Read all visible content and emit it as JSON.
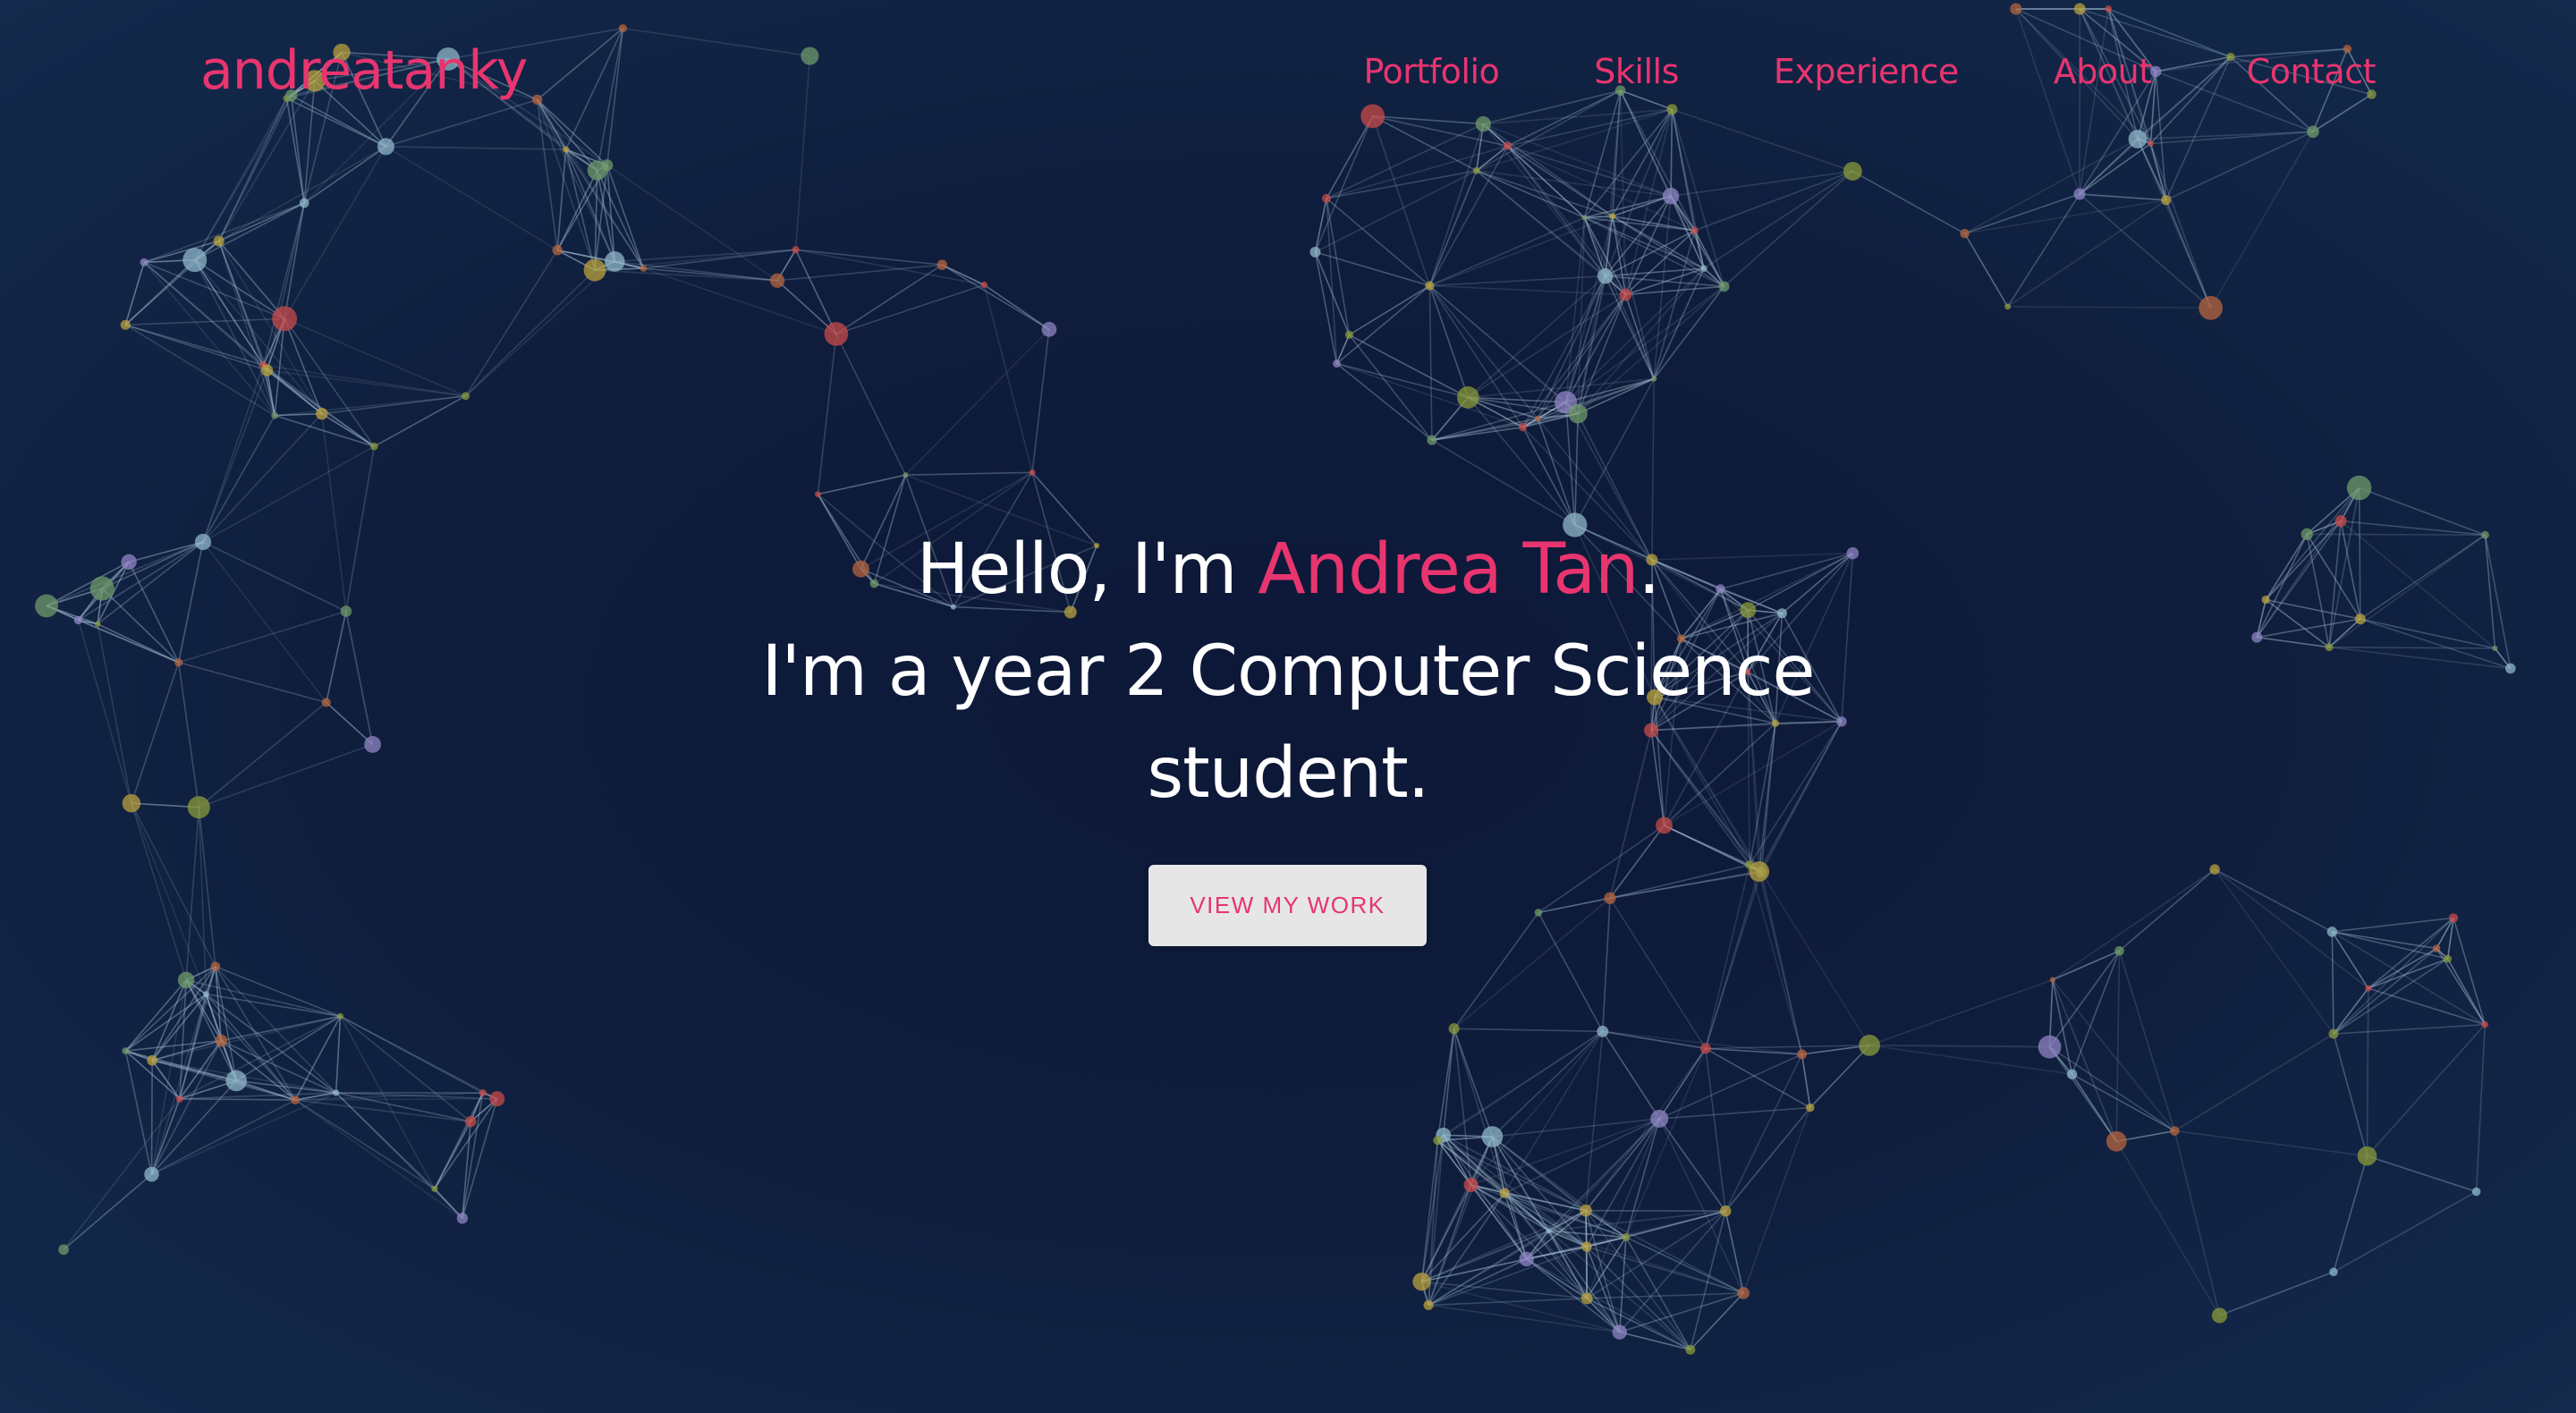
{
  "navbar": {
    "brand": "andreatanky",
    "links": [
      "Portfolio",
      "Skills",
      "Experience",
      "About",
      "Contact"
    ]
  },
  "hero": {
    "greeting_prefix": "Hello, I'm ",
    "name": "Andrea Tan",
    "greeting_suffix": ".",
    "line2": "I'm a year 2 Computer Science",
    "line3": "student.",
    "cta_label": "VIEW MY WORK"
  },
  "colors": {
    "accent": "#e8356f",
    "background": "#0f1c3b",
    "text": "#ffffff",
    "button_bg": "#e6e6e6"
  }
}
